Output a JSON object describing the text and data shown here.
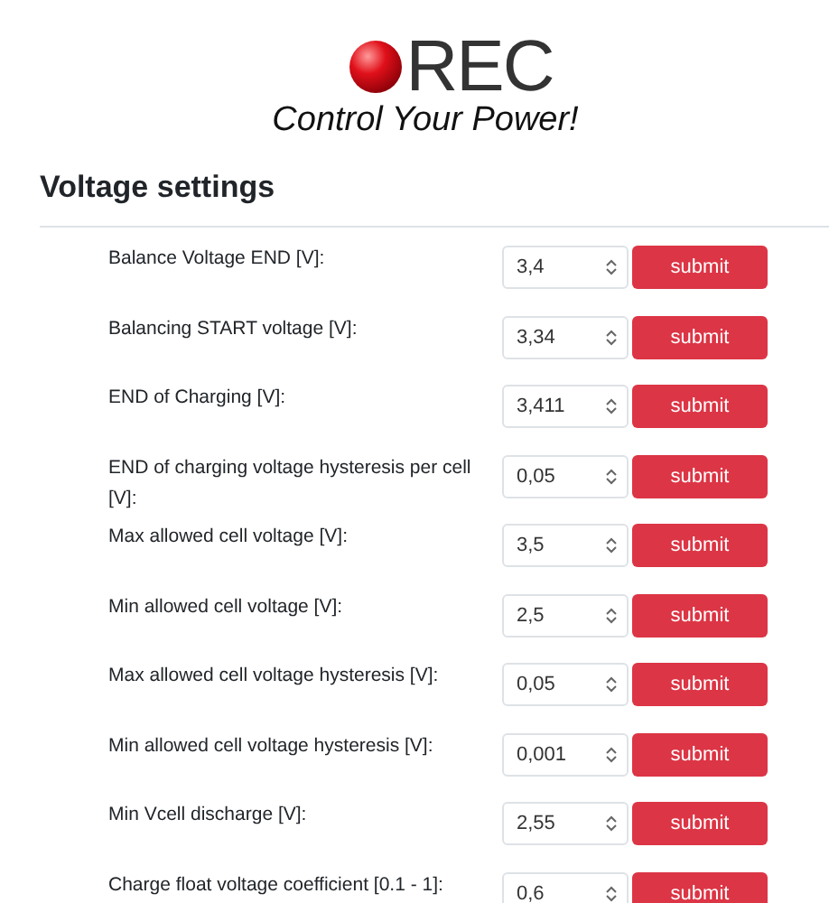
{
  "logo": {
    "brand": "REC",
    "tagline": "Control Your Power!"
  },
  "heading": "Voltage settings",
  "settings": [
    {
      "label": "Balance Voltage END [V]:",
      "value": "3,4",
      "button": "submit"
    },
    {
      "label": "Balancing START voltage [V]:",
      "value": "3,34",
      "button": "submit"
    },
    {
      "label": "END of Charging [V]:",
      "value": "3,411",
      "button": "submit"
    },
    {
      "label": "END of charging voltage hysteresis per cell [V]:",
      "value": "0,05",
      "button": "submit"
    },
    {
      "label": "Max allowed cell voltage [V]:",
      "value": "3,5",
      "button": "submit"
    },
    {
      "label": "Min allowed cell voltage [V]:",
      "value": "2,5",
      "button": "submit"
    },
    {
      "label": "Max allowed cell voltage hysteresis [V]:",
      "value": "0,05",
      "button": "submit"
    },
    {
      "label": "Min allowed cell voltage hysteresis [V]:",
      "value": "0,001",
      "button": "submit"
    },
    {
      "label": "Min Vcell discharge [V]:",
      "value": "2,55",
      "button": "submit"
    },
    {
      "label": "Charge float voltage coefficient [0.1 - 1]:",
      "value": "0,6",
      "button": "submit"
    }
  ]
}
